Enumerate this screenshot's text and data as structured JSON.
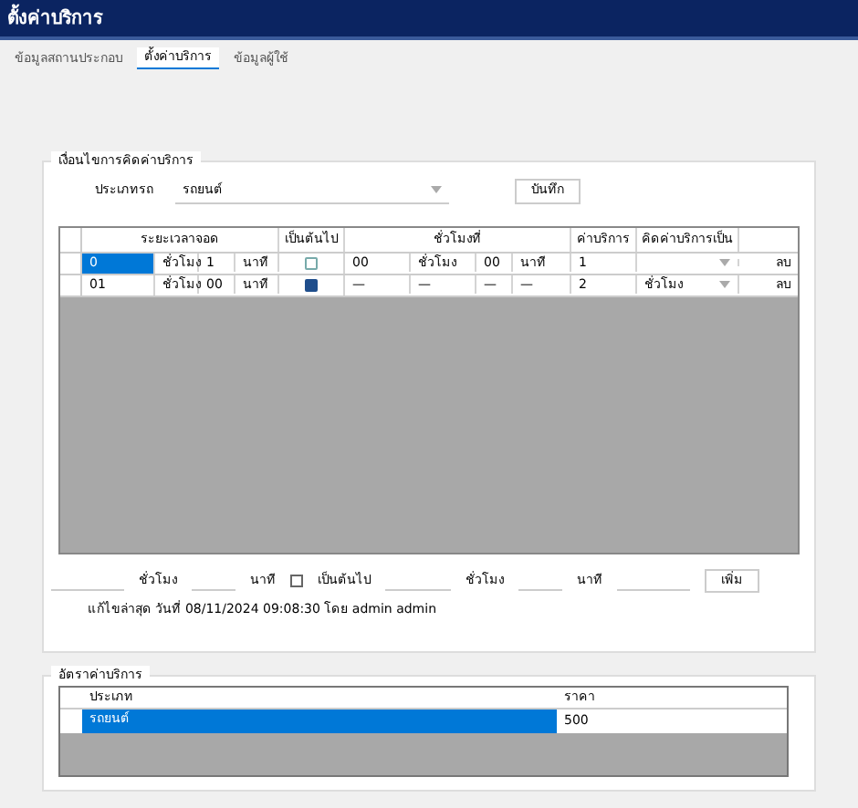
{
  "window": {
    "title": "ตั้งค่าบริการ"
  },
  "tabs": [
    {
      "label": "ข้อมูลสถานประกอบ",
      "selected": false
    },
    {
      "label": "ตั้งค่าบริการ",
      "selected": true
    },
    {
      "label": "ข้อมูลผู้ใช้",
      "selected": false
    }
  ],
  "conditions": {
    "title": "เงื่อนไขการคิดค่าบริการ",
    "vehicle_label": "ประเภทรถ",
    "vehicle_value": "รถยนต์",
    "save_button": "บันทึก",
    "table": {
      "columns": [
        "ระยะเวลาจอด",
        "เป็นต้นไป",
        "ชั่วโมงที่",
        "ค่าบริการ",
        "คิดค่าบริการเป็น"
      ],
      "rows": [
        {
          "selected": true,
          "from_hours": "0",
          "hour_unit": "ชั่วโมง",
          "from_minutes": "1",
          "minute_unit": "นาที",
          "onwards": false,
          "to_hours": "00",
          "to_hour_unit": "ชั่วโมง",
          "to_minutes": "00",
          "to_minute_unit": "นาที",
          "fee": "1",
          "charge_by": "",
          "delete": "ลบ"
        },
        {
          "selected": false,
          "from_hours": "01",
          "hour_unit": "ชั่วโมง",
          "from_minutes": "00",
          "minute_unit": "นาที",
          "onwards": true,
          "to_hours": "—",
          "to_hour_unit": "—",
          "to_minutes": "—",
          "to_minute_unit": "—",
          "fee": "2",
          "charge_by": "ชั่วโมง",
          "delete": "ลบ"
        }
      ]
    },
    "add_row": {
      "hour_unit": "ชั่วโมง",
      "minute_unit": "นาที",
      "onwards_label": "เป็นต้นไป",
      "onwards": false,
      "to_hour_unit": "ชั่วโมง",
      "to_minute_unit": "นาที",
      "add_button": "เพิ่ม"
    },
    "last_update": "แก้ไขล่าสุด วันที่ 08/11/2024 09:08:30 โดย admin admin"
  },
  "rates": {
    "title": "อัตราค่าบริการ",
    "columns": [
      "ประเภท",
      "ราคา"
    ],
    "rows": [
      {
        "type": "รถยนต์",
        "price": "500",
        "selected": true
      }
    ]
  }
}
